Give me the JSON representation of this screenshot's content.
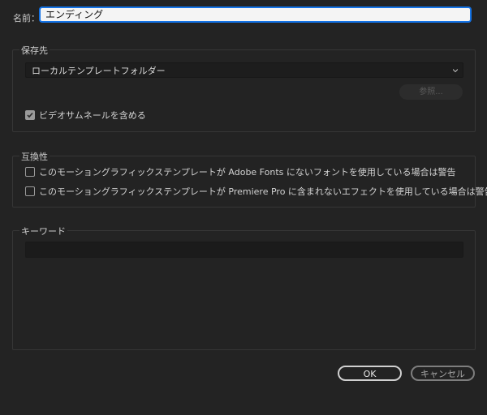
{
  "name": {
    "label": "名前：",
    "value": "エンディング"
  },
  "destination": {
    "title": "保存先",
    "selected": "ローカルテンプレートフォルダー",
    "browse_label": "参照...",
    "include_thumbnail_label": "ビデオサムネールを含める",
    "include_thumbnail_checked": true
  },
  "compatibility": {
    "title": "互換性",
    "option1_label": "このモーショングラフィックステンプレートが Adobe Fonts にないフォントを使用している場合は警告",
    "option1_checked": false,
    "option2_label": "このモーショングラフィックステンプレートが Premiere Pro に含まれないエフェクトを使用している場合は警告",
    "option2_checked": false
  },
  "keywords": {
    "title": "キーワード",
    "value": ""
  },
  "buttons": {
    "ok_label": "OK",
    "cancel_label": "キャンセル"
  }
}
